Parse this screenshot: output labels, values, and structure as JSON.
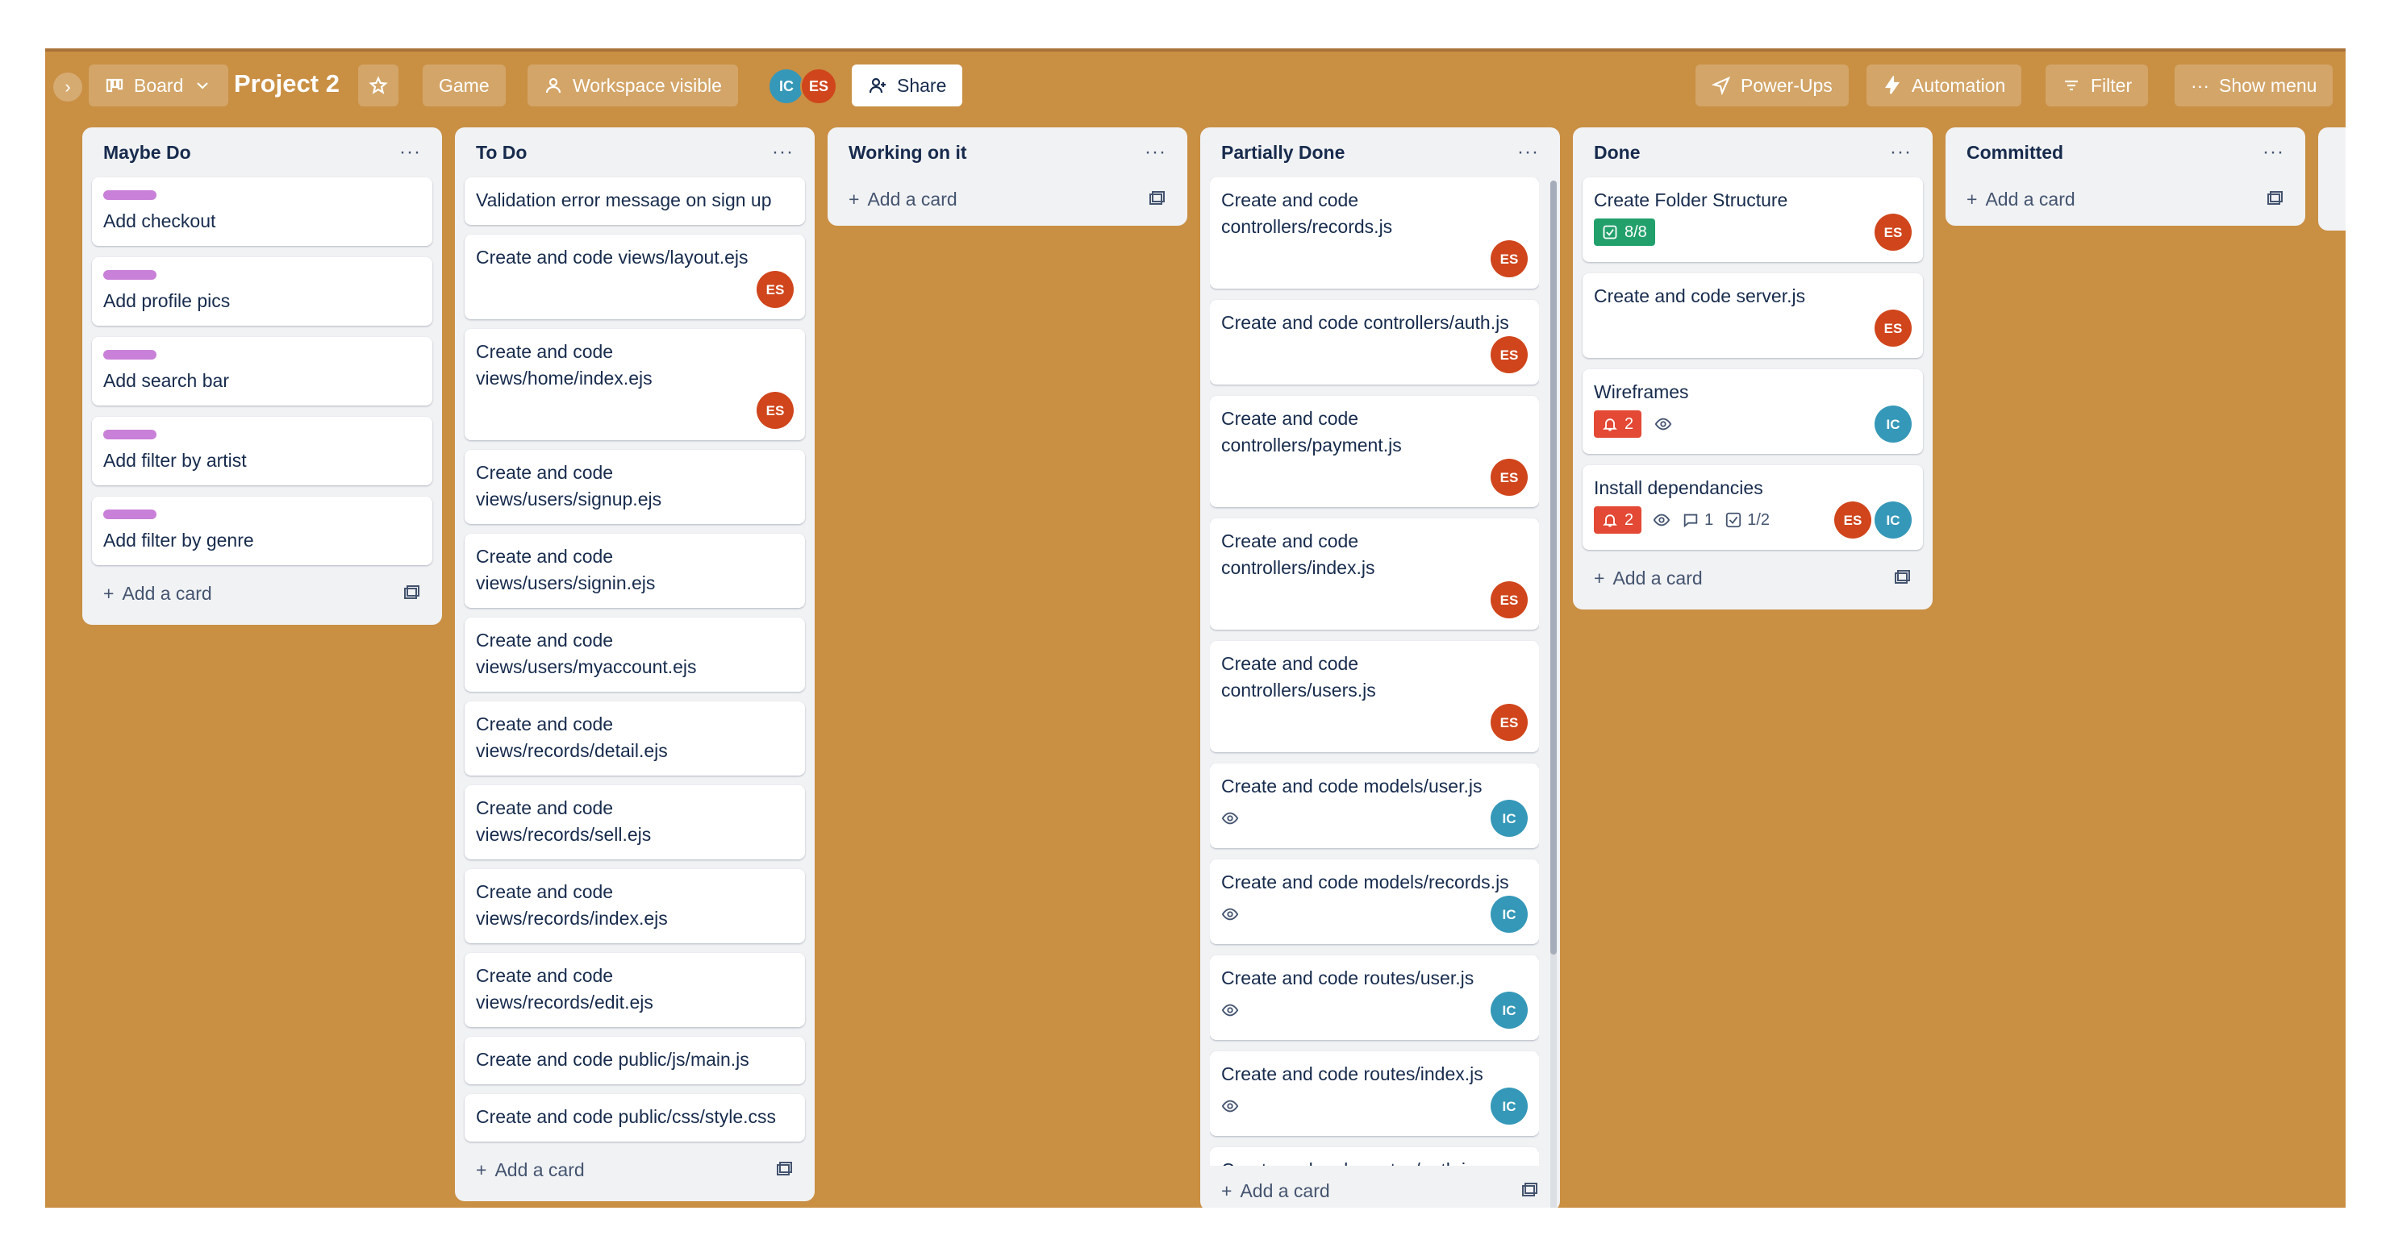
{
  "header": {
    "view_label": "Board",
    "title": "Project 2",
    "game_label": "Game",
    "visibility_label": "Workspace visible",
    "member_initials": [
      "IC",
      "ES"
    ],
    "share_label": "Share",
    "powerups_label": "Power-Ups",
    "automation_label": "Automation",
    "filter_label": "Filter",
    "menu_label": "Show menu"
  },
  "colors": {
    "board_bg": "#c98f43",
    "label_purple": "#c980d8",
    "avatar_es": "#d0451b",
    "avatar_ic": "#3598b8",
    "badge_green": "#22a06b",
    "badge_red": "#e34935"
  },
  "add_card_label": "Add a card",
  "lists": [
    {
      "title": "Maybe Do",
      "cards": [
        {
          "title": "Add checkout",
          "label": "purple"
        },
        {
          "title": "Add profile pics",
          "label": "purple"
        },
        {
          "title": "Add search bar",
          "label": "purple"
        },
        {
          "title": "Add filter by artist",
          "label": "purple"
        },
        {
          "title": "Add filter by genre",
          "label": "purple"
        }
      ]
    },
    {
      "title": "To Do",
      "cards": [
        {
          "title": "Validation error message on sign up"
        },
        {
          "title": "Create and code views/layout.ejs",
          "member": "ES"
        },
        {
          "title": "Create and code views/home/index.ejs",
          "member": "ES"
        },
        {
          "title": "Create and code views/users/signup.ejs"
        },
        {
          "title": "Create and code views/users/signin.ejs"
        },
        {
          "title": "Create and code views/users/myaccount.ejs"
        },
        {
          "title": "Create and code views/records/detail.ejs"
        },
        {
          "title": "Create and code views/records/sell.ejs"
        },
        {
          "title": "Create and code views/records/index.ejs"
        },
        {
          "title": "Create and code views/records/edit.ejs"
        },
        {
          "title": "Create and code public/js/main.js"
        },
        {
          "title": "Create and code public/css/style.css"
        }
      ]
    },
    {
      "title": "Working on it",
      "cards": []
    },
    {
      "title": "Partially Done",
      "cards": [
        {
          "title": "Create and code controllers/records.js",
          "member": "ES"
        },
        {
          "title": "Create and code controllers/auth.js",
          "member": "ES"
        },
        {
          "title": "Create and code controllers/payment.js",
          "member": "ES"
        },
        {
          "title": "Create and code controllers/index.js",
          "member": "ES"
        },
        {
          "title": "Create and code controllers/users.js",
          "member": "ES"
        },
        {
          "title": "Create and code models/user.js",
          "watch": true,
          "member": "IC"
        },
        {
          "title": "Create and code models/records.js",
          "watch": true,
          "member": "IC"
        },
        {
          "title": "Create and code routes/user.js",
          "watch": true,
          "member": "IC"
        },
        {
          "title": "Create and code routes/index.js",
          "watch": true,
          "member": "IC"
        },
        {
          "title": "Create and code routes/auth.js"
        }
      ]
    },
    {
      "title": "Done",
      "cards": [
        {
          "title": "Create Folder Structure",
          "checklist": "8/8",
          "member": "ES"
        },
        {
          "title": "Create and code server.js",
          "member": "ES"
        },
        {
          "title": "Wireframes",
          "alerts": "2",
          "watch": true,
          "member": "IC"
        },
        {
          "title": "Install dependancies",
          "alerts": "2",
          "watch": true,
          "comments": "1",
          "checklist_partial": "1/2",
          "members": [
            "ES",
            "IC"
          ]
        }
      ]
    },
    {
      "title": "Committed",
      "cards": []
    }
  ]
}
